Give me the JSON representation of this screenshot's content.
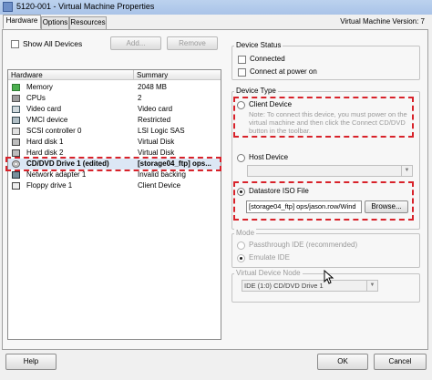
{
  "window": {
    "title": "5120-001 - Virtual Machine Properties",
    "vm_version": "Virtual Machine Version: 7"
  },
  "tabs": [
    {
      "label": "Hardware",
      "active": true
    },
    {
      "label": "Options",
      "active": false
    },
    {
      "label": "Resources",
      "active": false
    }
  ],
  "hardware": {
    "show_all_devices": "Show All Devices",
    "add_button": "Add...",
    "remove_button": "Remove",
    "columns": [
      "Hardware",
      "Summary"
    ],
    "rows": [
      {
        "name": "Memory",
        "summary": "2048 MB",
        "icon": "memory-icon"
      },
      {
        "name": "CPUs",
        "summary": "2",
        "icon": "cpu-icon"
      },
      {
        "name": "Video card",
        "summary": "Video card",
        "icon": "video-card-icon"
      },
      {
        "name": "VMCI device",
        "summary": "Restricted",
        "icon": "vmci-icon"
      },
      {
        "name": "SCSI controller 0",
        "summary": "LSI Logic SAS",
        "icon": "scsi-controller-icon"
      },
      {
        "name": "Hard disk 1",
        "summary": "Virtual Disk",
        "icon": "hard-disk-icon"
      },
      {
        "name": "Hard disk 2",
        "summary": "Virtual Disk",
        "icon": "hard-disk-icon"
      },
      {
        "name": "CD/DVD Drive 1 (edited)",
        "summary": "[storage04_ftp] ops...",
        "icon": "cd-dvd-icon",
        "selected": true
      },
      {
        "name": "Network adapter 1",
        "summary": "Invalid backing",
        "icon": "network-adapter-icon"
      },
      {
        "name": "Floppy drive 1",
        "summary": "Client Device",
        "icon": "floppy-icon"
      }
    ]
  },
  "device_status": {
    "label": "Device Status",
    "connected": "Connected",
    "connect_at_power_on": "Connect at power on"
  },
  "device_type": {
    "label": "Device Type",
    "client_device": "Client Device",
    "client_note": "Note: To connect this device, you must power on the virtual machine and then click the Connect CD/DVD button in the toolbar.",
    "host_device": "Host Device",
    "datastore_iso": "Datastore ISO File",
    "iso_path": "[storage04_ftp] ops/jason.row/Wind",
    "browse_button": "Browse..."
  },
  "mode": {
    "label": "Mode",
    "passthrough": "Passthrough IDE (recommended)",
    "emulate": "Emulate IDE"
  },
  "virtual_device_node": {
    "label": "Virtual Device Node",
    "value": "IDE (1:0) CD/DVD Drive 1"
  },
  "footer": {
    "help": "Help",
    "ok": "OK",
    "cancel": "Cancel"
  },
  "colors": {
    "highlight_dash": "#d8222a",
    "selection": "#dce7f5",
    "titlebar": "#bcd2ee"
  }
}
